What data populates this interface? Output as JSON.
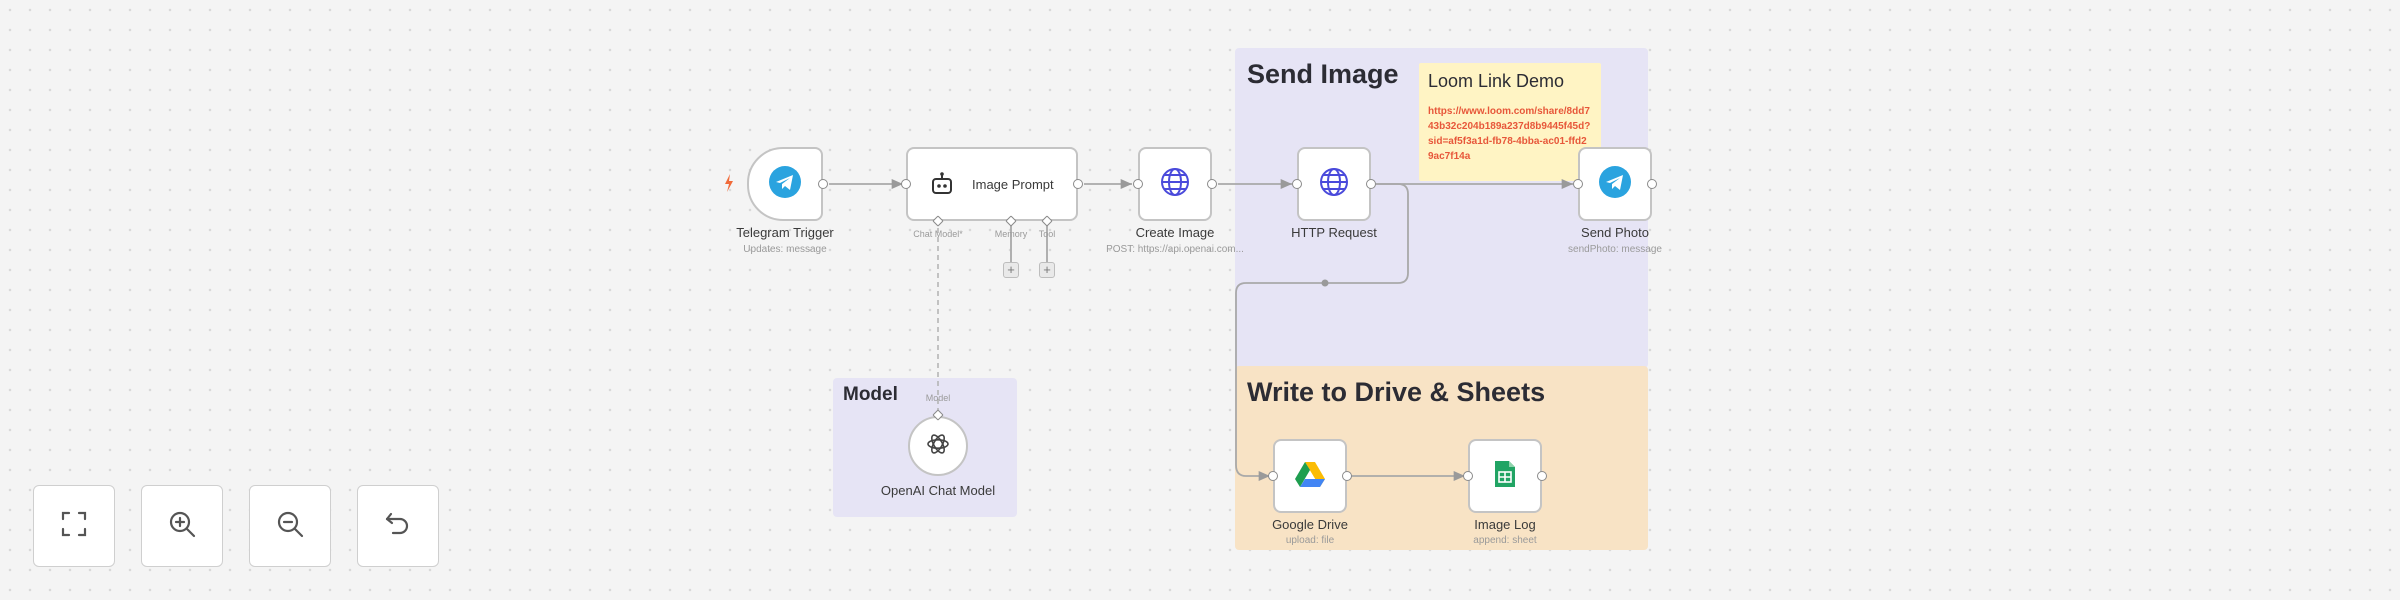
{
  "canvas": {
    "sticky_send_image": "Send Image",
    "sticky_write_drive": "Write to Drive & Sheets",
    "sticky_model": "Model",
    "loom_note": {
      "title": "Loom Link Demo",
      "link": "https://www.loom.com/share/8dd743b32c204b189a237d8b9445f45d?sid=af5f3a1d-fb78-4bba-ac01-ffd29ac7f14a"
    }
  },
  "nodes": {
    "telegram_trigger": {
      "label": "Telegram Trigger",
      "sub": "Updates: message",
      "icon": "telegram-icon"
    },
    "image_prompt": {
      "label": "Image Prompt",
      "icon": "robot-icon",
      "ports": {
        "chat_model": "Chat Model*",
        "memory": "Memory",
        "tool": "Tool"
      }
    },
    "create_image": {
      "label": "Create Image",
      "sub": "POST: https://api.openai.com...",
      "icon": "globe-icon"
    },
    "http_request": {
      "label": "HTTP Request",
      "icon": "globe-icon"
    },
    "send_photo": {
      "label": "Send Photo",
      "sub": "sendPhoto: message",
      "icon": "telegram-icon"
    },
    "openai_chat_model": {
      "label": "OpenAI Chat Model",
      "port": "Model",
      "icon": "openai-icon"
    },
    "google_drive": {
      "label": "Google Drive",
      "sub": "upload: file",
      "icon": "google-drive-icon"
    },
    "image_log": {
      "label": "Image Log",
      "sub": "append: sheet",
      "icon": "google-sheets-icon"
    }
  },
  "controls": [
    {
      "name": "fit-view-button",
      "icon": "fit-view-icon"
    },
    {
      "name": "zoom-in-button",
      "icon": "zoom-in-icon"
    },
    {
      "name": "zoom-out-button",
      "icon": "zoom-out-icon"
    },
    {
      "name": "undo-button",
      "icon": "undo-icon"
    }
  ],
  "colors": {
    "canvas_bg": "#f4f4f4",
    "sticky_purple": "#e6e4f5",
    "sticky_orange": "#f8e3c5",
    "sticky_yellow": "#fff4c4",
    "telegram_blue": "#2aa3df",
    "globe_blue": "#4a4adb",
    "trigger_orange": "#f06b3a",
    "drive_green": "#1e9e50",
    "sheets_green": "#21a464"
  }
}
